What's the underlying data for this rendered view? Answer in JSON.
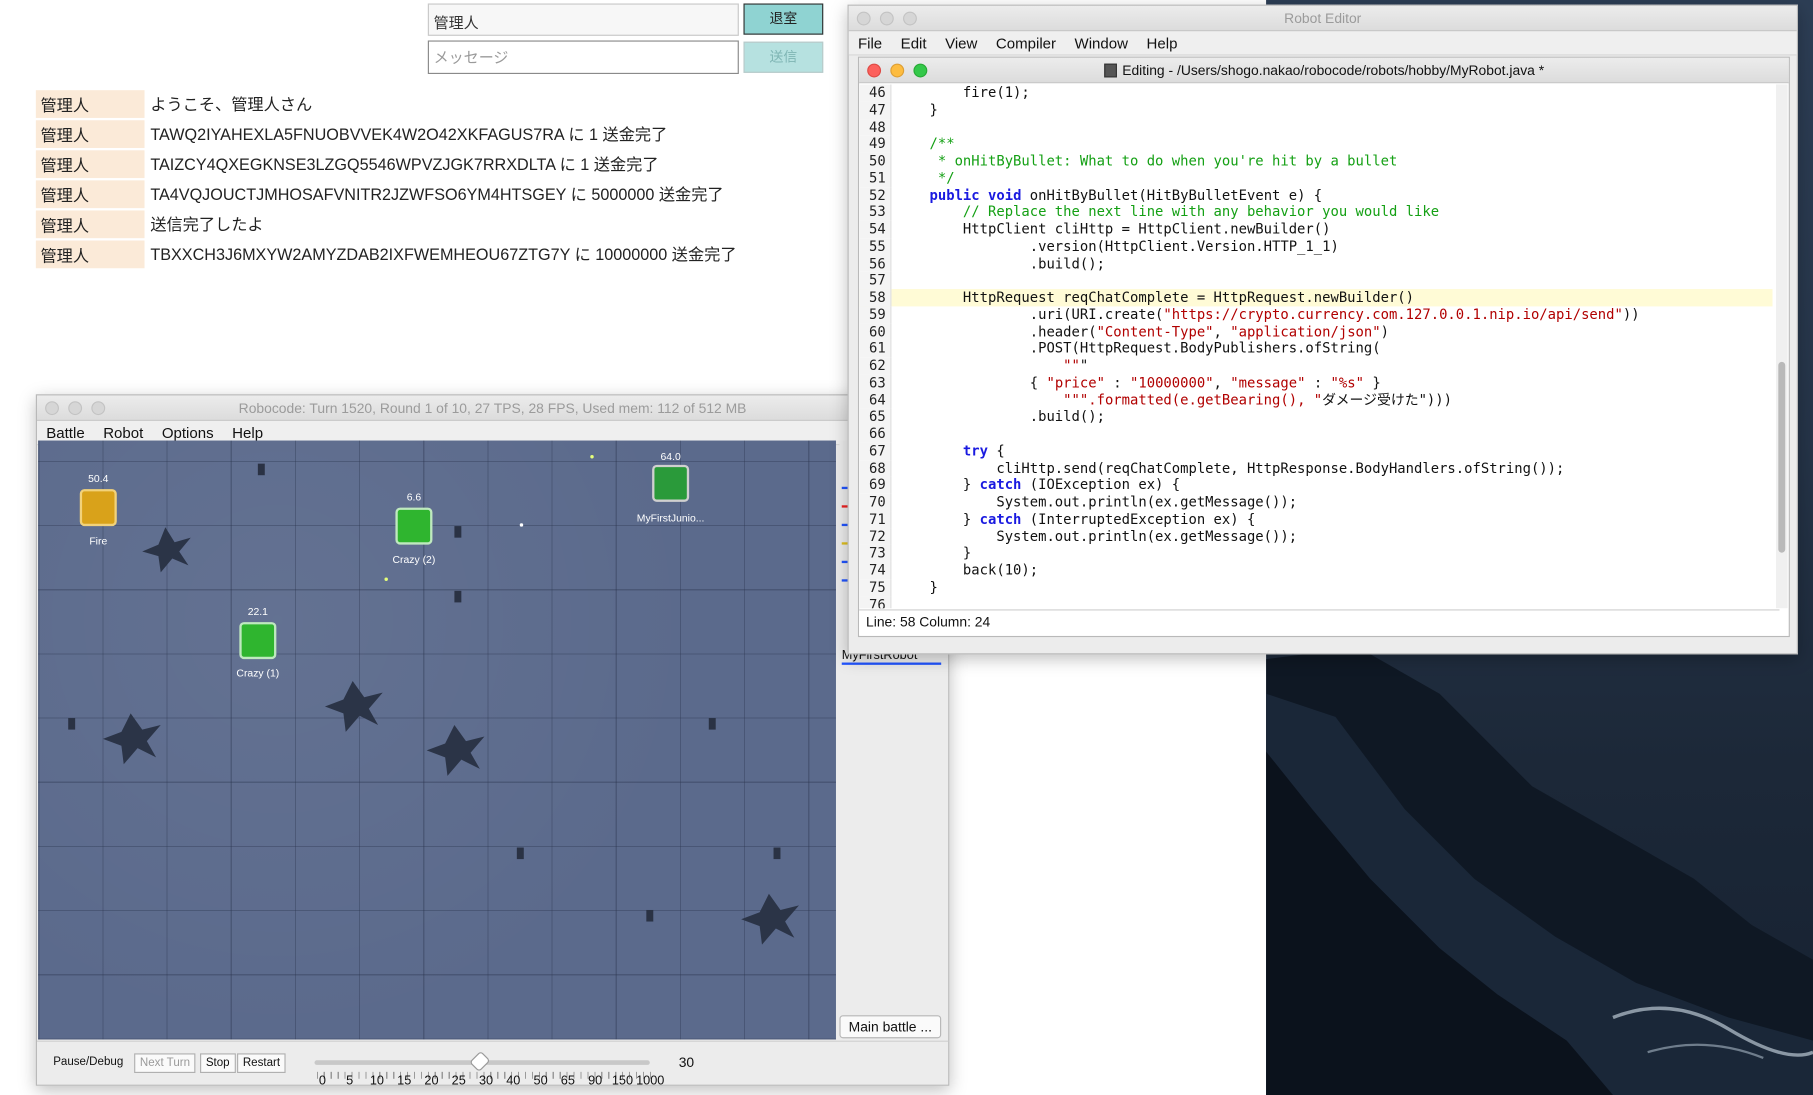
{
  "chat": {
    "name_value": "管理人",
    "message_placeholder": "メッセージ",
    "leave_label": "退室",
    "send_label": "送信",
    "log": [
      {
        "user": "管理人",
        "text": "ようこそ、管理人さん"
      },
      {
        "user": "管理人",
        "text": "TAWQ2IYAHEXLA5FNUOBVVEK4W2O42XKFAGUS7RA に 1 送金完了"
      },
      {
        "user": "管理人",
        "text": "TAIZCY4QXEGKNSE3LZGQ5546WPVZJGK7RRXDLTA に 1 送金完了"
      },
      {
        "user": "管理人",
        "text": "TA4VQJOUCTJMHOSAFVNITR2JZWFSO6YM4HTSGEY に 5000000 送金完了"
      },
      {
        "user": "管理人",
        "text": "送信完了したよ"
      },
      {
        "user": "管理人",
        "text": "TBXXCH3J6MXYW2AMYZDAB2IXFWEMHEOU67ZTG7Y に 10000000 送金完了"
      }
    ]
  },
  "robocode": {
    "title": "Robocode: Turn 1520, Round 1 of 10, 27 TPS, 28 FPS, Used mem: 112 of 512 MB",
    "menu": [
      "Battle",
      "Robot",
      "Options",
      "Help"
    ],
    "robots": [
      {
        "name": "Fire",
        "energy": "50.4",
        "color": "#d9a21a"
      },
      {
        "name": "Crazy (2)",
        "energy": "6.6",
        "color": "#2fb52f"
      },
      {
        "name": "MyFirstJunio...",
        "energy": "64.0",
        "color": "#2a9a3a"
      },
      {
        "name": "Crazy (1)",
        "energy": "22.1",
        "color": "#2fb52f"
      }
    ],
    "side_label": "MyFirstRobot",
    "main_battle_label": "Main battle ...",
    "buttons": {
      "pause": "Pause/Debug",
      "next_turn": "Next Turn",
      "stop": "Stop",
      "restart": "Restart"
    },
    "speed_ticks": [
      "0",
      "5",
      "10",
      "15",
      "20",
      "25",
      "30",
      "40",
      "50",
      "65",
      "90",
      "150",
      "1000"
    ],
    "speed_value": "30"
  },
  "editor": {
    "title": "Robot Editor",
    "menu": [
      "File",
      "Edit",
      "View",
      "Compiler",
      "Window",
      "Help"
    ],
    "doc_title": "Editing - /Users/shogo.nakao/robocode/robots/hobby/MyRobot.java *",
    "status": "Line: 58 Column: 24",
    "lines": [
      {
        "n": "46",
        "t": "        fire(1);"
      },
      {
        "n": "47",
        "t": "    }"
      },
      {
        "n": "48",
        "t": ""
      },
      {
        "n": "49",
        "t": "    /**"
      },
      {
        "n": "50",
        "t": "     * onHitByBullet: What to do when you're hit by a bullet"
      },
      {
        "n": "51",
        "t": "     */"
      },
      {
        "n": "52",
        "t": "    public void onHitByBullet(HitByBulletEvent e) {"
      },
      {
        "n": "53",
        "t": "        // Replace the next line with any behavior you would like"
      },
      {
        "n": "54",
        "t": "        HttpClient cliHttp = HttpClient.newBuilder()"
      },
      {
        "n": "55",
        "t": "                .version(HttpClient.Version.HTTP_1_1)"
      },
      {
        "n": "56",
        "t": "                .build();"
      },
      {
        "n": "57",
        "t": ""
      },
      {
        "n": "58",
        "t": "        HttpRequest reqChatComplete = HttpRequest.newBuilder()"
      },
      {
        "n": "59",
        "t": "                .uri(URI.create(\"https://crypto.currency.com.127.0.0.1.nip.io/api/send\"))"
      },
      {
        "n": "60",
        "t": "                .header(\"Content-Type\", \"application/json\")"
      },
      {
        "n": "61",
        "t": "                .POST(HttpRequest.BodyPublishers.ofString("
      },
      {
        "n": "62",
        "t": "                    \"\"\""
      },
      {
        "n": "63",
        "t": "                { \"price\" : \"10000000\", \"message\" : \"%s\" }"
      },
      {
        "n": "64",
        "t": "                    \"\"\".formatted(e.getBearing(), \"ダメージ受けた\")))"
      },
      {
        "n": "65",
        "t": "                .build();"
      },
      {
        "n": "66",
        "t": ""
      },
      {
        "n": "67",
        "t": "        try {"
      },
      {
        "n": "68",
        "t": "            cliHttp.send(reqChatComplete, HttpResponse.BodyHandlers.ofString());"
      },
      {
        "n": "69",
        "t": "        } catch (IOException ex) {"
      },
      {
        "n": "70",
        "t": "            System.out.println(ex.getMessage());"
      },
      {
        "n": "71",
        "t": "        } catch (InterruptedException ex) {"
      },
      {
        "n": "72",
        "t": "            System.out.println(ex.getMessage());"
      },
      {
        "n": "73",
        "t": "        }"
      },
      {
        "n": "74",
        "t": "        back(10);"
      },
      {
        "n": "75",
        "t": "    }"
      },
      {
        "n": "76",
        "t": ""
      }
    ]
  }
}
